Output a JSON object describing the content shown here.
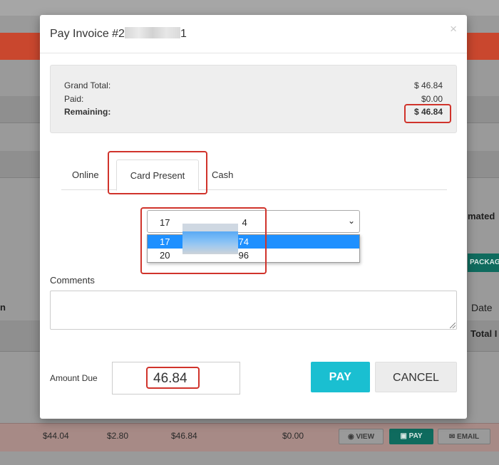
{
  "background": {
    "right_labels": [
      "mated",
      "Date",
      "Total I"
    ],
    "package_label": "PACKAGE",
    "left_heading": "n",
    "row": {
      "cells": [
        "$44.04",
        "$2.80",
        "$46.84",
        "$0.00"
      ],
      "view_label": "VIEW",
      "pay_label": "PAY",
      "email_label": "EMAIL"
    }
  },
  "modal": {
    "title_prefix": "Pay Invoice #2",
    "title_suffix": "1",
    "close_glyph": "×",
    "summary": {
      "grand_total_label": "Grand Total:",
      "grand_total_value": "$ 46.84",
      "paid_label": "Paid:",
      "paid_value": "$0.00",
      "remaining_label": "Remaining:",
      "remaining_value": "$ 46.84"
    },
    "tabs": [
      "Online",
      "Card Present",
      "Cash"
    ],
    "active_tab": "Card Present",
    "card_select": {
      "selected_prefix": "17",
      "selected_suffix": "4",
      "options": [
        {
          "prefix": "17",
          "suffix": "74",
          "highlighted": true
        },
        {
          "prefix": "20",
          "suffix": "96",
          "highlighted": false
        }
      ]
    },
    "comments_label": "Comments",
    "comments_value": "",
    "amount_due_label": "Amount Due",
    "amount_due_value": "46.84",
    "pay_button": "PAY",
    "cancel_button": "CANCEL"
  },
  "colors": {
    "accent_teal": "#1abfd1",
    "highlight_red": "#d0332b",
    "select_blue": "#1e90ff",
    "header_red": "#c9472e"
  },
  "icons": {
    "close": "close-icon",
    "chevron": "chevron-down-icon",
    "view": "eye-icon",
    "pay": "money-icon",
    "email": "envelope-icon"
  }
}
